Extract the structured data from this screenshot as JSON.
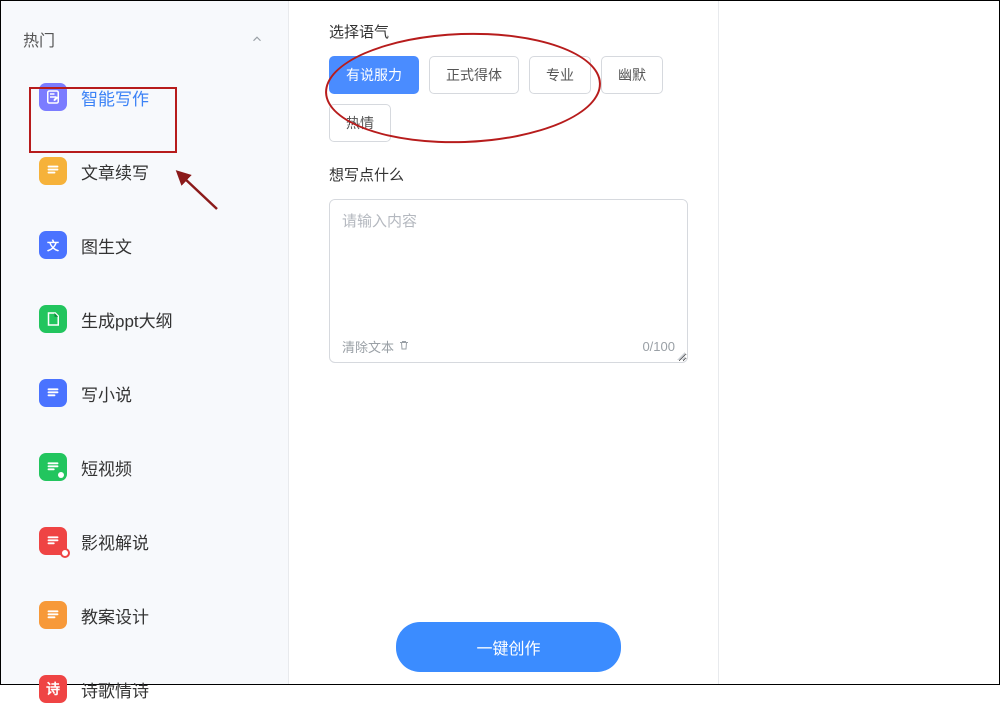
{
  "sidebar": {
    "section_label": "热门",
    "items": [
      {
        "label": "智能写作",
        "icon": "doc-edit-icon",
        "color": "ic-violet",
        "active": true
      },
      {
        "label": "文章续写",
        "icon": "doc-lines-icon",
        "color": "ic-yellow",
        "active": false
      },
      {
        "label": "图生文",
        "icon": "translate-icon",
        "color": "ic-blue",
        "active": false,
        "glyph": "文"
      },
      {
        "label": "生成ppt大纲",
        "icon": "doc-fold-icon",
        "color": "ic-green",
        "active": false
      },
      {
        "label": "写小说",
        "icon": "doc-lines-icon",
        "color": "ic-blue",
        "active": false
      },
      {
        "label": "短视频",
        "icon": "doc-dot-icon",
        "color": "ic-green-dot",
        "active": false
      },
      {
        "label": "影视解说",
        "icon": "doc-play-icon",
        "color": "ic-red",
        "active": false
      },
      {
        "label": "教案设计",
        "icon": "doc-lines-icon",
        "color": "ic-orange",
        "active": false
      },
      {
        "label": "诗歌情诗",
        "icon": "poetry-icon",
        "color": "ic-crimson",
        "active": false,
        "glyph": "诗"
      }
    ]
  },
  "form": {
    "tone_label": "选择语气",
    "tones": [
      {
        "label": "有说服力",
        "selected": true
      },
      {
        "label": "正式得体",
        "selected": false
      },
      {
        "label": "专业",
        "selected": false
      },
      {
        "label": "幽默",
        "selected": false
      },
      {
        "label": "热情",
        "selected": false
      }
    ],
    "content_label": "想写点什么",
    "content_placeholder": "请输入内容",
    "clear_label": "清除文本",
    "counter": "0/100",
    "generate_label": "一键创作"
  }
}
